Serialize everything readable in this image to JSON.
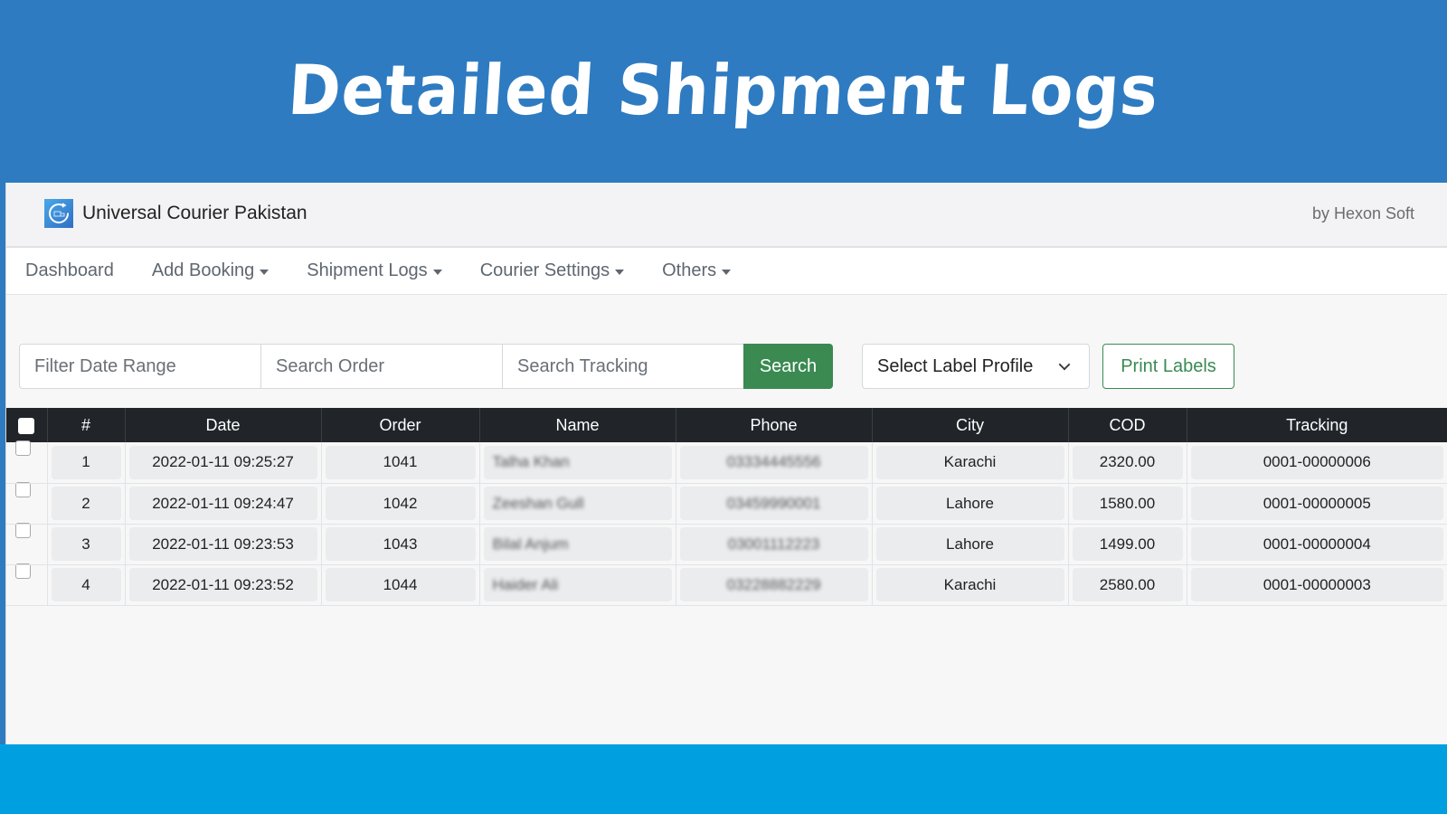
{
  "banner": {
    "title": "Detailed Shipment Logs"
  },
  "app": {
    "brand_name": "Universal Courier Pakistan",
    "byline": "by Hexon Soft",
    "logo_icon": "courier-refresh-truck-icon"
  },
  "nav": {
    "items": [
      {
        "label": "Dashboard",
        "dropdown": false
      },
      {
        "label": "Add Booking",
        "dropdown": true
      },
      {
        "label": "Shipment Logs",
        "dropdown": true
      },
      {
        "label": "Courier Settings",
        "dropdown": true
      },
      {
        "label": "Others",
        "dropdown": true
      }
    ]
  },
  "toolbar": {
    "date_range_placeholder": "Filter Date Range",
    "order_placeholder": "Search Order",
    "tracking_placeholder": "Search Tracking",
    "search_label": "Search",
    "label_profile_selected": "Select Label Profile",
    "print_label": "Print Labels"
  },
  "table": {
    "columns": [
      "",
      "#",
      "Date",
      "Order",
      "Name",
      "Phone",
      "City",
      "COD",
      "Tracking"
    ],
    "rows": [
      {
        "num": "1",
        "date": "2022-01-11 09:25:27",
        "order": "1041",
        "name": "Talha Khan",
        "phone": "03334445556",
        "city": "Karachi",
        "cod": "2320.00",
        "tracking": "0001-00000006"
      },
      {
        "num": "2",
        "date": "2022-01-11 09:24:47",
        "order": "1042",
        "name": "Zeeshan Gull",
        "phone": "03459990001",
        "city": "Lahore",
        "cod": "1580.00",
        "tracking": "0001-00000005"
      },
      {
        "num": "3",
        "date": "2022-01-11 09:23:53",
        "order": "1043",
        "name": "Bilal Anjum",
        "phone": "03001112223",
        "city": "Lahore",
        "cod": "1499.00",
        "tracking": "0001-00000004"
      },
      {
        "num": "4",
        "date": "2022-01-11 09:23:52",
        "order": "1044",
        "name": "Haider Ali",
        "phone": "03228882229",
        "city": "Karachi",
        "cod": "2580.00",
        "tracking": "0001-00000003"
      }
    ]
  },
  "colors": {
    "banner_blue": "#2e7bc1",
    "footer_blue": "#00a0e0",
    "success_green": "#3a8a52",
    "table_header": "#212529"
  }
}
